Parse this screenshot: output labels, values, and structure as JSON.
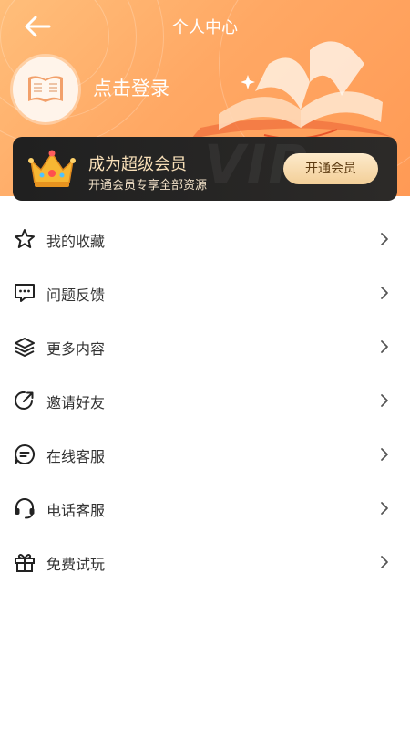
{
  "header": {
    "title": "个人中心",
    "login_text": "点击登录"
  },
  "vip": {
    "title": "成为超级会员",
    "subtitle": "开通会员专享全部资源",
    "button": "开通会员",
    "watermark": "VIP"
  },
  "menu": {
    "items": [
      {
        "label": "我的收藏",
        "icon": "star-icon"
      },
      {
        "label": "问题反馈",
        "icon": "chat-icon"
      },
      {
        "label": "更多内容",
        "icon": "layers-icon"
      },
      {
        "label": "邀请好友",
        "icon": "share-icon"
      },
      {
        "label": "在线客服",
        "icon": "message-icon"
      },
      {
        "label": "电话客服",
        "icon": "headset-icon"
      },
      {
        "label": "免费试玩",
        "icon": "gift-icon"
      }
    ]
  },
  "colors": {
    "header_gradient": [
      "#ffbe7a",
      "#ff9a55"
    ],
    "vip_card": "#202020",
    "vip_text": "#f8dfb8",
    "vip_button": "#f3cf98",
    "menu_text": "#333333"
  }
}
